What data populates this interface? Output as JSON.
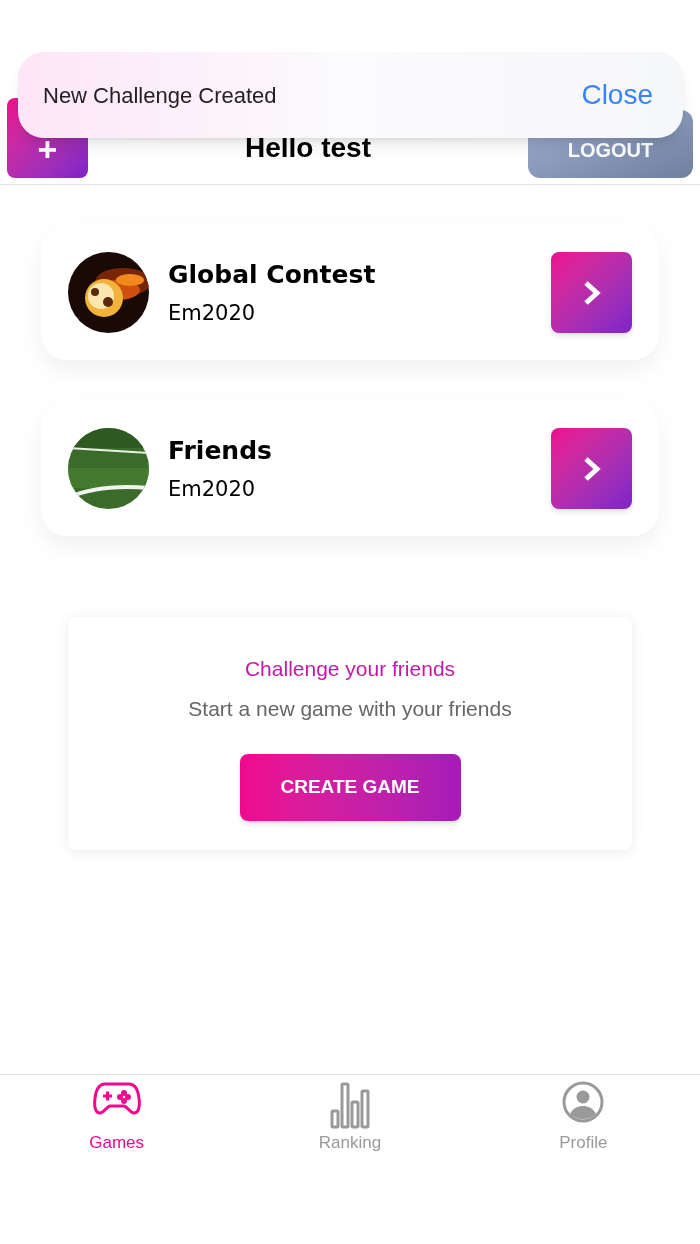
{
  "toast": {
    "message": "New Challenge Created",
    "action": "Close"
  },
  "header": {
    "add_button": "+",
    "title": "Hello test",
    "logout_button": "LOGOUT"
  },
  "contests": [
    {
      "title": "Global Contest",
      "subtitle": "Em2020",
      "kind": "fire"
    },
    {
      "title": "Friends",
      "subtitle": "Em2020",
      "kind": "pitch"
    }
  ],
  "challenge_card": {
    "heading": "Challenge your friends",
    "text": "Start a new game with your friends",
    "button": "CREATE GAME"
  },
  "tab_bar": [
    {
      "label": "Games",
      "kind": "games",
      "selected": true
    },
    {
      "label": "Ranking",
      "kind": "ranking",
      "selected": false
    },
    {
      "label": "Profile",
      "kind": "profile",
      "selected": false
    }
  ]
}
